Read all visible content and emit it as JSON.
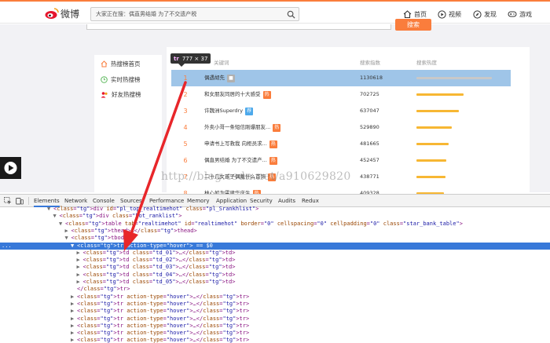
{
  "header": {
    "logo_text": "微博",
    "search_placeholder": "大家正在搜：偶直男结婚 为了不交遗产税",
    "nav": [
      "首页",
      "视频",
      "发现",
      "游戏"
    ],
    "search_button": "搜索"
  },
  "sidebar": {
    "items": [
      "热搜榜首页",
      "实时热搜榜",
      "好友热搜榜"
    ]
  },
  "table": {
    "headers": [
      "关键词",
      "搜索指数",
      "搜索热度"
    ],
    "rows": [
      {
        "rank": "1",
        "title": "偶遇胡先",
        "badge": "",
        "index": "1130618",
        "heat": 1.0
      },
      {
        "rank": "2",
        "title": "和女朋友同居的十大感受",
        "badge": "热",
        "index": "702725",
        "heat": 0.62
      },
      {
        "rank": "3",
        "title": "许魏洲Superdry",
        "badge": "荐",
        "index": "637047",
        "heat": 0.56
      },
      {
        "rank": "4",
        "title": "外卖小哥一条短信刚爆朋友...",
        "badge": "热",
        "index": "529890",
        "heat": 0.47
      },
      {
        "rank": "5",
        "title": "申请书上写救我 向柜员求...",
        "badge": "热",
        "index": "481665",
        "heat": 0.43
      },
      {
        "rank": "6",
        "title": "偶直男结婚 为了不交遗产...",
        "badge": "热",
        "index": "452457",
        "heat": 0.4
      },
      {
        "rank": "7",
        "title": "二十几女孩子偶戴什么首饰",
        "badge": "热",
        "index": "438771",
        "heat": 0.39
      },
      {
        "rank": "8",
        "title": "林心如为霍建华庆生",
        "badge": "热",
        "index": "409328",
        "heat": 0.36
      }
    ]
  },
  "tooltip": {
    "tag": "tr",
    "size": "777 × 37"
  },
  "watermark": "http://blog.csdn.net/a910629820",
  "devtools": {
    "tabs": [
      "Elements",
      "Network",
      "Console",
      "Sources",
      "Performance",
      "Memory",
      "Application",
      "Security",
      "Audits",
      "Redux"
    ],
    "lines": [
      {
        "indent": 8,
        "tri": "▼",
        "html": "<div id=\"pl_top_realtimehot\" class=\"pl_Srankhlist\">"
      },
      {
        "indent": 9,
        "tri": "▼",
        "html": "<div class=\"hot_ranklist\">"
      },
      {
        "indent": 10,
        "tri": "▼",
        "html": "<table tab=\"realtimehot\" id=\"realtimehot\" border=\"0\" cellspacing=\"0\" cellpadding=\"0\" class=\"star_bank_table\">"
      },
      {
        "indent": 11,
        "tri": "▶",
        "html": "<thead>…</thead>"
      },
      {
        "indent": 11,
        "tri": "▼",
        "html": "<tbody>"
      },
      {
        "indent": 12,
        "tri": "▼",
        "html": "<tr action-type=\"hover\"> == $0",
        "selected": true
      },
      {
        "indent": 13,
        "tri": "▶",
        "html": "<td class=\"td_01\">…</td>"
      },
      {
        "indent": 13,
        "tri": "▶",
        "html": "<td class=\"td_02\">…</td>"
      },
      {
        "indent": 13,
        "tri": "▶",
        "html": "<td class=\"td_03\">…</td>"
      },
      {
        "indent": 13,
        "tri": "▶",
        "html": "<td class=\"td_04\">…</td>"
      },
      {
        "indent": 13,
        "tri": "▶",
        "html": "<td class=\"td_05\">…</td>"
      },
      {
        "indent": 12,
        "tri": "",
        "html": "</tr>"
      },
      {
        "indent": 12,
        "tri": "▶",
        "html": "<tr action-type=\"hover\">…</tr>"
      },
      {
        "indent": 12,
        "tri": "▶",
        "html": "<tr action-type=\"hover\">…</tr>"
      },
      {
        "indent": 12,
        "tri": "▶",
        "html": "<tr action-type=\"hover\">…</tr>"
      },
      {
        "indent": 12,
        "tri": "▶",
        "html": "<tr action-type=\"hover\">…</tr>"
      },
      {
        "indent": 12,
        "tri": "▶",
        "html": "<tr action-type=\"hover\">…</tr>"
      },
      {
        "indent": 12,
        "tri": "▶",
        "html": "<tr action-type=\"hover\">…</tr>"
      },
      {
        "indent": 12,
        "tri": "▶",
        "html": "<tr action-type=\"hover\">…</tr>"
      }
    ],
    "selected_marker": "..."
  },
  "colors": {
    "accent": "#fa7d3c",
    "selection": "#3879d9",
    "row_highlight": "#9fc5e8",
    "arrow": "#e8262a"
  }
}
